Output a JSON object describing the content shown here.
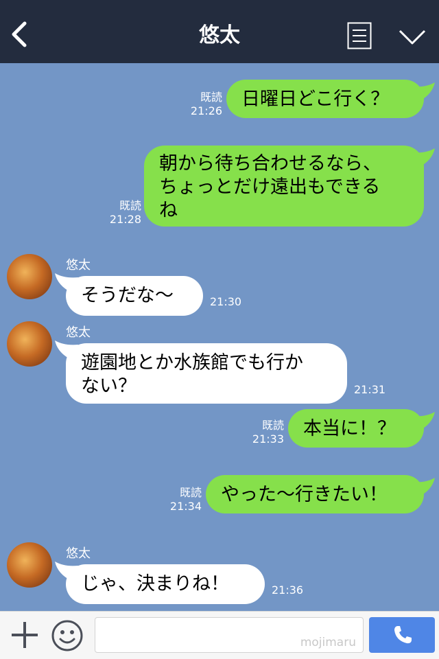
{
  "header": {
    "title": "悠太"
  },
  "contact": {
    "name": "悠太"
  },
  "messages": [
    {
      "text": "日曜日どこ行く？",
      "read": "既読",
      "time": "21:26"
    },
    {
      "line1": "朝から待ち合わせるなら、",
      "line2": "ちょっとだけ遠出もできる",
      "line3": "ね",
      "read": "既読",
      "time": "21:28"
    },
    {
      "text": "そうだな〜",
      "time": "21:30"
    },
    {
      "line1": "遊園地とか水族館でも行か",
      "line2": "ない？",
      "time": "21:31"
    },
    {
      "text": "本当に！？",
      "read": "既読",
      "time": "21:33"
    },
    {
      "text": "やった〜行きたい！",
      "read": "既読",
      "time": "21:34"
    },
    {
      "text": "じゃ、決まりね！",
      "time": "21:36"
    }
  ],
  "footer": {
    "watermark": "mojimaru"
  },
  "colors": {
    "header": "#232c3e",
    "background": "#7396c6",
    "sent_bubble": "#86e04b",
    "received_bubble": "#ffffff",
    "call_button": "#4f86e6"
  },
  "icons": [
    "back-icon",
    "menu-icon",
    "chevron-down-icon",
    "plus-icon",
    "smile-icon",
    "phone-icon"
  ]
}
